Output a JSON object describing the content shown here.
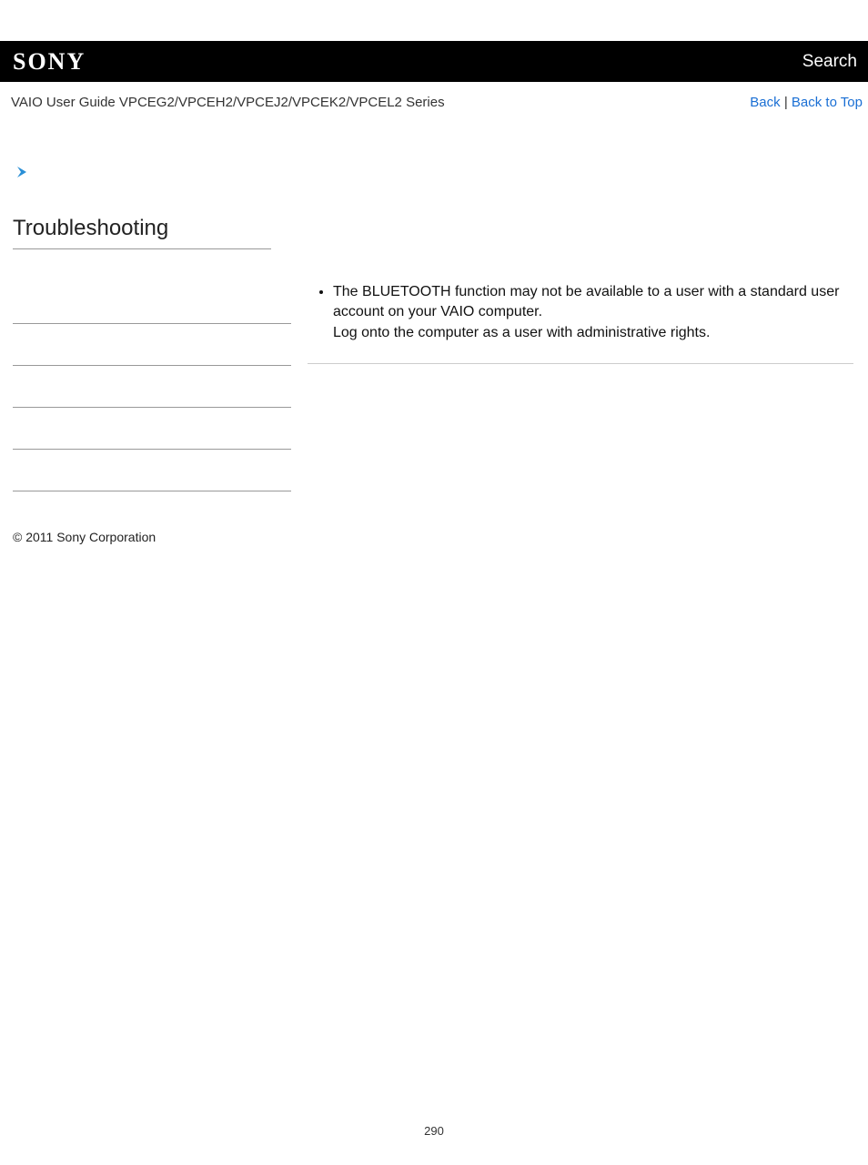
{
  "header": {
    "logo": "SONY",
    "search": "Search"
  },
  "subheader": {
    "guide_title": "VAIO User Guide VPCEG2/VPCEH2/VPCEJ2/VPCEK2/VPCEL2 Series",
    "back": "Back",
    "separator": " | ",
    "back_to_top": "Back to Top"
  },
  "section": {
    "title": "Troubleshooting"
  },
  "content": {
    "bullet1_line1": "The BLUETOOTH function may not be available to a user with a standard user account on your VAIO computer.",
    "bullet1_line2": "Log onto the computer as a user with administrative rights."
  },
  "footer": {
    "copyright": "© 2011 Sony Corporation",
    "page_number": "290"
  }
}
